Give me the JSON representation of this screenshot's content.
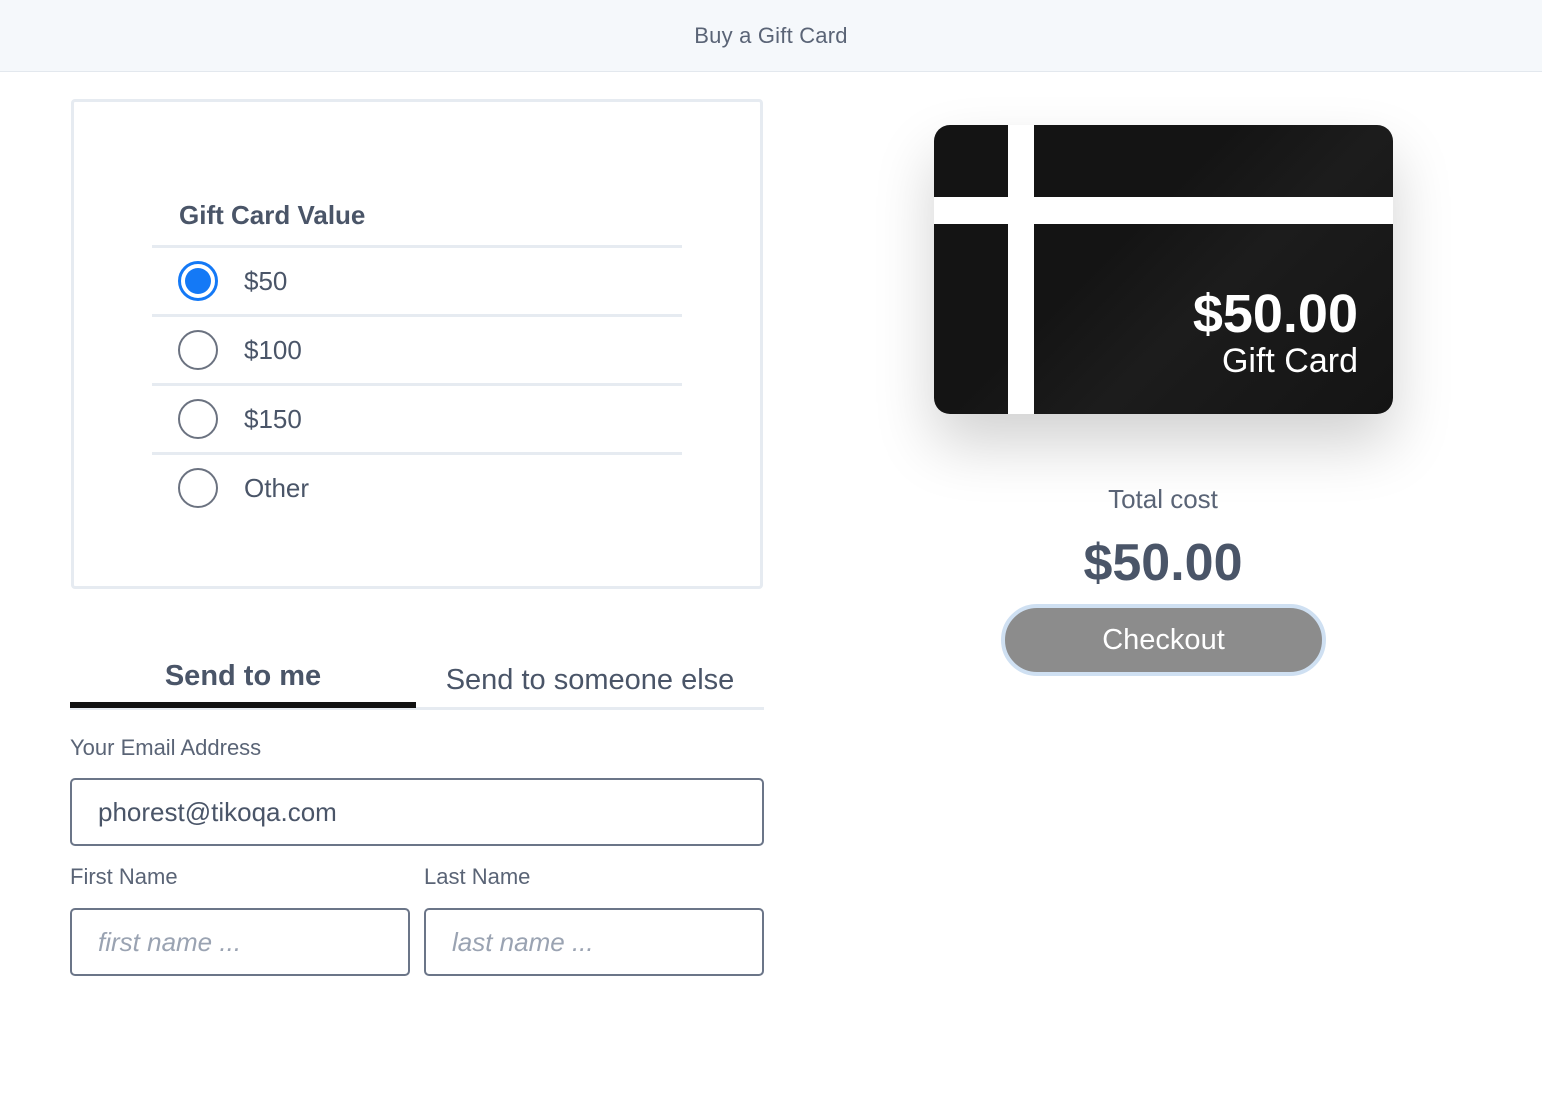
{
  "header": {
    "title": "Buy a Gift Card"
  },
  "gift_value": {
    "heading": "Gift Card Value",
    "options": [
      {
        "label": "$50",
        "checked": true
      },
      {
        "label": "$100",
        "checked": false
      },
      {
        "label": "$150",
        "checked": false
      },
      {
        "label": "Other",
        "checked": false
      }
    ]
  },
  "tabs": {
    "send_to_me": "Send to me",
    "send_to_else": "Send to someone else",
    "active": "send_to_me"
  },
  "form": {
    "email_label": "Your Email Address",
    "email_value": "phorest@tikoqa.com",
    "first_label": "First Name",
    "first_placeholder": "first name ...",
    "last_label": "Last Name",
    "last_placeholder": "last name ..."
  },
  "card": {
    "amount": "$50.00",
    "subtitle": "Gift Card"
  },
  "summary": {
    "total_label": "Total cost",
    "total_value": "$50.00",
    "checkout_label": "Checkout"
  },
  "colors": {
    "accent": "#1479f6",
    "checkout_bg": "#8c8c8c",
    "card_bg": "#141414"
  }
}
